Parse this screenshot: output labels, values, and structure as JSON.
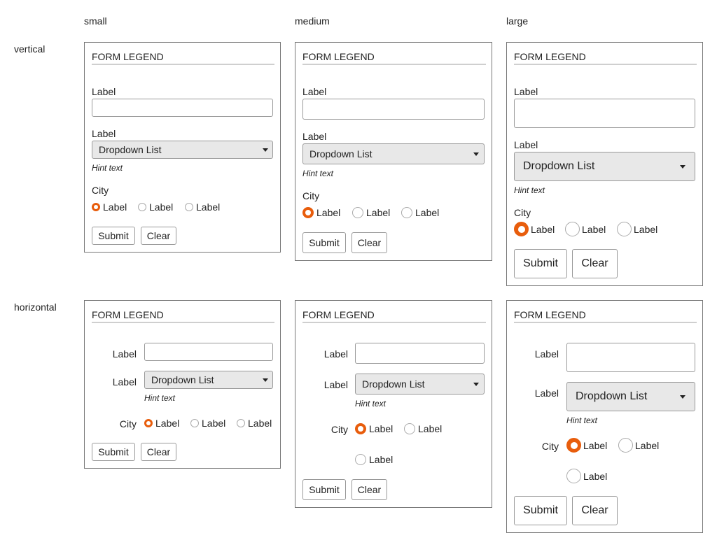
{
  "columns": {
    "small": "small",
    "medium": "medium",
    "large": "large"
  },
  "rows": {
    "vertical": "vertical",
    "horizontal": "horizontal"
  },
  "form": {
    "legend": "FORM LEGEND",
    "text_label": "Label",
    "select_label": "Label",
    "select_value": "Dropdown List",
    "hint": "Hint text",
    "city_label": "City",
    "radio_labels": [
      "Label",
      "Label",
      "Label"
    ],
    "submit": "Submit",
    "clear": "Clear"
  },
  "colors": {
    "accent": "#e85d0c"
  },
  "icons": {
    "dropdown": "caret-down-icon"
  }
}
